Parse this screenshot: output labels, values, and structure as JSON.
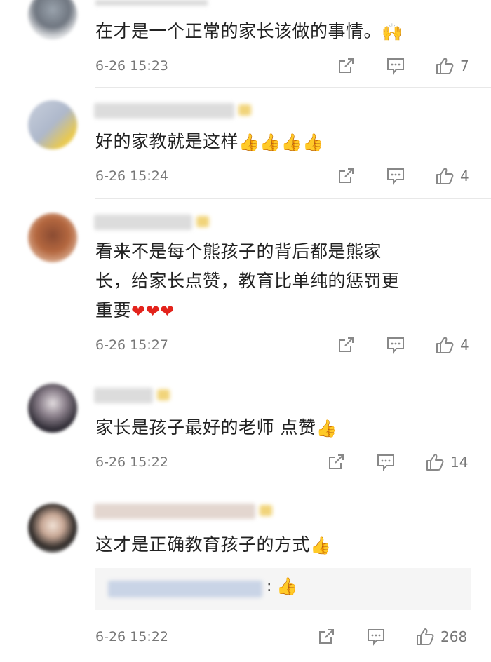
{
  "comments": [
    {
      "text": "在才是一个正常的家长该做的事情。",
      "emoji": "🙌",
      "time": "6-26 15:23",
      "likes": "7"
    },
    {
      "text": "好的家教就是这样",
      "emoji": "👍👍👍👍",
      "time": "6-26 15:24",
      "likes": "4"
    },
    {
      "lines": [
        "看来不是每个熊孩子的背后都是熊家",
        "长，给家长点赞，教育比单纯的惩罚更",
        "重要"
      ],
      "emoji": "❤❤❤",
      "time": "6-26 15:27",
      "likes": "4"
    },
    {
      "text": "家长是孩子最好的老师 点赞",
      "emoji": "👍",
      "time": "6-26 15:22",
      "likes": "14"
    },
    {
      "text": "这才是正确教育孩子的方式",
      "emoji": "👍",
      "reply": {
        "colon": ":",
        "emoji": "👍"
      },
      "time": "6-26 15:22",
      "likes": "268"
    }
  ],
  "icons": {
    "share": "share-icon",
    "comment": "comment-icon",
    "like": "like-icon"
  },
  "colors": {
    "thumb": "#f2b24d",
    "heart": "#e3231c",
    "meta_text": "#777777"
  }
}
